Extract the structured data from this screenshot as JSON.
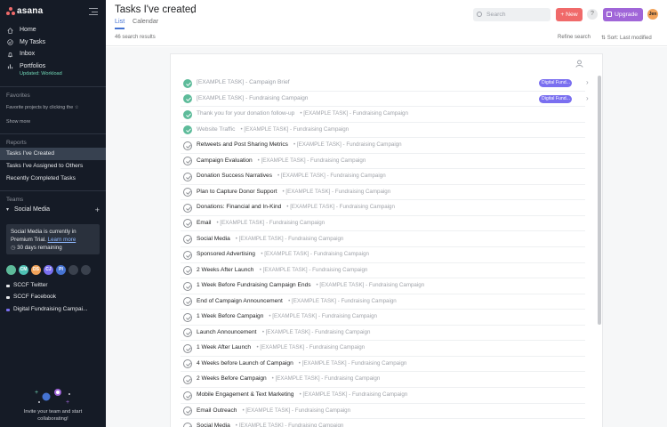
{
  "app": {
    "logo": "asana"
  },
  "sidebar": {
    "nav": [
      {
        "label": "Home",
        "icon": "home-icon"
      },
      {
        "label": "My Tasks",
        "icon": "check-circle-icon"
      },
      {
        "label": "Inbox",
        "icon": "bell-icon"
      },
      {
        "label": "Portfolios",
        "icon": "bar-chart-icon"
      }
    ],
    "portfolios_sub": "Updated: Workload",
    "favorites_title": "Favorites",
    "favorites_hint": "Favorite projects by clicking the ☆",
    "show_more": "Show more",
    "reports_title": "Reports",
    "reports": [
      {
        "label": "Tasks I've Created"
      },
      {
        "label": "Tasks I've Assigned to Others"
      },
      {
        "label": "Recently Completed Tasks"
      }
    ],
    "teams_title": "Teams",
    "team_name": "Social Media",
    "trial_text_1": "Social Media is currently in",
    "trial_text_2": "Premium Trial.",
    "trial_link": "Learn more",
    "trial_days": "30 days remaining",
    "avatars": [
      {
        "initials": "",
        "color": "#5dbb9a"
      },
      {
        "initials": "CM",
        "color": "#4ec0b3"
      },
      {
        "initials": "DS",
        "color": "#f1a35a"
      },
      {
        "initials": "CJ",
        "color": "#7a6ff0"
      },
      {
        "initials": "PI",
        "color": "#4573d2"
      },
      {
        "initials": "",
        "color": "#3a414d"
      },
      {
        "initials": "",
        "color": "#3a414d"
      }
    ],
    "projects": [
      {
        "label": "SCCF Twitter",
        "color": "#e6e8eb"
      },
      {
        "label": "SCCF Facebook",
        "color": "#e6e8eb"
      },
      {
        "label": "Digital Fundraising Campai...",
        "color": "#7a6ff0"
      }
    ],
    "invite_1": "Invite your team and start",
    "invite_2": "collaborating!"
  },
  "header": {
    "title": "Tasks I've created",
    "tabs": [
      {
        "label": "List"
      },
      {
        "label": "Calendar"
      }
    ],
    "search_placeholder": "Search",
    "new_label": "+ New",
    "help_label": "?",
    "upgrade_label": "Upgrade",
    "user_initials": "Jen",
    "results_count": "46 search results",
    "refine_label": "Refine search",
    "sort_label": "⇅ Sort: Last modified"
  },
  "tasks": [
    {
      "name": "[EXAMPLE TASK] - Campaign Brief",
      "project": "",
      "done": true,
      "tag": "Digital Fund..."
    },
    {
      "name": "[EXAMPLE TASK] - Fundraising Campaign",
      "project": "",
      "done": true,
      "tag": "Digital Fund..."
    },
    {
      "name": "Thank you for your donation follow-up",
      "project": "[EXAMPLE TASK] - Fundraising Campaign",
      "done": true,
      "tag": ""
    },
    {
      "name": "Website Traffic",
      "project": "[EXAMPLE TASK] - Fundraising Campaign",
      "done": true,
      "tag": ""
    },
    {
      "name": "Retweets and Post Sharing Metrics",
      "project": "[EXAMPLE TASK] - Fundraising Campaign",
      "done": false,
      "tag": ""
    },
    {
      "name": "Campaign Evaluation",
      "project": "[EXAMPLE TASK] - Fundraising Campaign",
      "done": false,
      "tag": ""
    },
    {
      "name": "Donation Success Narratives",
      "project": "[EXAMPLE TASK] - Fundraising Campaign",
      "done": false,
      "tag": ""
    },
    {
      "name": "Plan to Capture Donor Support",
      "project": "[EXAMPLE TASK] - Fundraising Campaign",
      "done": false,
      "tag": ""
    },
    {
      "name": "Donations: Financial and In-Kind",
      "project": "[EXAMPLE TASK] - Fundraising Campaign",
      "done": false,
      "tag": ""
    },
    {
      "name": "Email",
      "project": "[EXAMPLE TASK] - Fundraising Campaign",
      "done": false,
      "tag": ""
    },
    {
      "name": "Social Media",
      "project": "[EXAMPLE TASK] - Fundraising Campaign",
      "done": false,
      "tag": ""
    },
    {
      "name": "Sponsored Advertising",
      "project": "[EXAMPLE TASK] - Fundraising Campaign",
      "done": false,
      "tag": ""
    },
    {
      "name": "2 Weeks After Launch",
      "project": "[EXAMPLE TASK] - Fundraising Campaign",
      "done": false,
      "tag": ""
    },
    {
      "name": "1 Week Before Fundraising Campaign Ends",
      "project": "[EXAMPLE TASK] - Fundraising Campaign",
      "done": false,
      "tag": ""
    },
    {
      "name": "End of Campaign Announcement",
      "project": "[EXAMPLE TASK] - Fundraising Campaign",
      "done": false,
      "tag": ""
    },
    {
      "name": "1 Week Before Campaign",
      "project": "[EXAMPLE TASK] - Fundraising Campaign",
      "done": false,
      "tag": ""
    },
    {
      "name": "Launch Announcement",
      "project": "[EXAMPLE TASK] - Fundraising Campaign",
      "done": false,
      "tag": ""
    },
    {
      "name": "1 Week After Launch",
      "project": "[EXAMPLE TASK] - Fundraising Campaign",
      "done": false,
      "tag": ""
    },
    {
      "name": "4 Weeks before Launch of Campaign",
      "project": "[EXAMPLE TASK] - Fundraising Campaign",
      "done": false,
      "tag": ""
    },
    {
      "name": "2 Weeks Before Campaign",
      "project": "[EXAMPLE TASK] - Fundraising Campaign",
      "done": false,
      "tag": ""
    },
    {
      "name": "Mobile Engagement & Text Marketing",
      "project": "[EXAMPLE TASK] - Fundraising Campaign",
      "done": false,
      "tag": ""
    },
    {
      "name": "Email Outreach",
      "project": "[EXAMPLE TASK] - Fundraising Campaign",
      "done": false,
      "tag": ""
    },
    {
      "name": "Social Media",
      "project": "[EXAMPLE TASK] - Fundraising Campaign",
      "done": false,
      "tag": ""
    }
  ]
}
